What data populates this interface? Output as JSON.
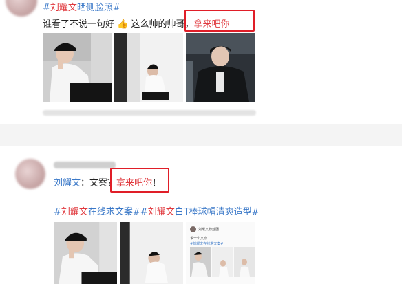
{
  "post1": {
    "hashtag_prefix": "#",
    "hashtag_name": "刘耀文",
    "hashtag_suffix": "晒侧脸照#",
    "text_before": "谁看了不说一句好",
    "thumb_emoji": "👍",
    "text_middle": "这么帅的帅哥，",
    "highlight": "拿来吧你",
    "photos": [
      "photo-1",
      "photo-2",
      "photo-3"
    ]
  },
  "post2": {
    "mention": "刘耀文",
    "text_body": "：文案？",
    "highlight": "拿来吧你",
    "text_end": "！",
    "tag1_prefix": "#",
    "tag1_name": "刘耀文",
    "tag1_suffix": "在线求文案##",
    "tag2_name": "刘耀文",
    "tag2_suffix": "白T棒球帽清爽造型#",
    "mini_post": {
      "name": "刘耀文粉丝团",
      "text": "求一个文案",
      "tags": "#刘耀文在线求文案#"
    }
  },
  "colors": {
    "link_blue": "#3a78c8",
    "highlight_red": "#e0393e",
    "box_red": "#e01e28"
  }
}
